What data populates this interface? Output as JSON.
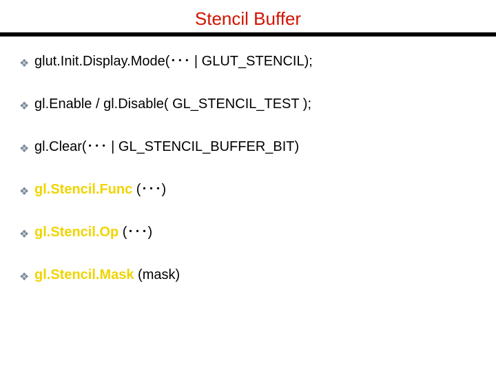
{
  "title": "Stencil Buffer",
  "bullet_glyph": "❖",
  "items": [
    {
      "plain": "glut.Init.Display.Mode(･･･ | GLUT_STENCIL);"
    },
    {
      "plain": "gl.Enable / gl.Disable( GL_STENCIL_TEST );"
    },
    {
      "plain": "gl.Clear(･･･ | GL_STENCIL_BUFFER_BIT)"
    },
    {
      "hl": "gl.Stencil.Func",
      "tail": " (･･･)"
    },
    {
      "hl": "gl.Stencil.Op",
      "tail": " (･･･)"
    },
    {
      "hl": "gl.Stencil.Mask",
      "tail": " (mask)"
    }
  ]
}
